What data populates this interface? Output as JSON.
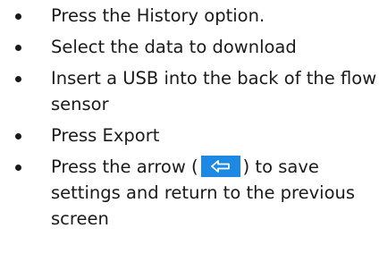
{
  "instructions": {
    "steps": [
      {
        "text": "Press the History option."
      },
      {
        "text": "Select the data to download"
      },
      {
        "text": "Insert a USB into the back of the flow sensor"
      },
      {
        "text": "Press Export"
      },
      {
        "text_before": "Press the arrow (",
        "icon": "back-arrow-icon",
        "text_after": ") to save settings and return to the previous screen"
      }
    ]
  },
  "colors": {
    "text": "#1a1a1a",
    "arrow_button": "#1e88e5",
    "arrow_glyph": "#ffffff"
  }
}
